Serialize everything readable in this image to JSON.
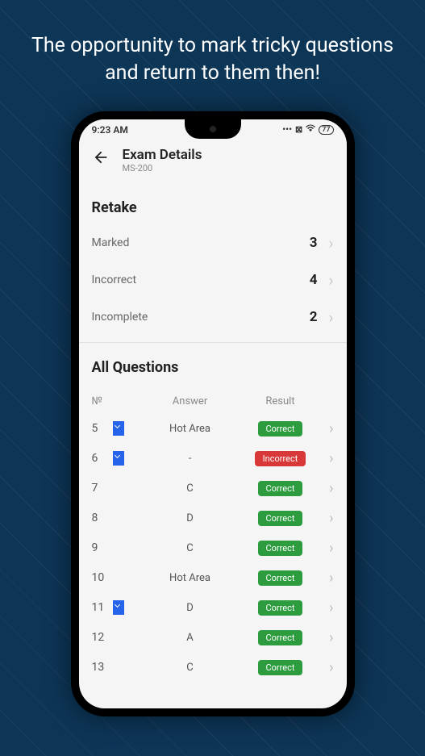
{
  "promo": "The opportunity to mark tricky questions and return to them then!",
  "statusBar": {
    "time": "9:23 AM",
    "battery": "77"
  },
  "header": {
    "title": "Exam Details",
    "subtitle": "MS-200"
  },
  "retake": {
    "title": "Retake",
    "rows": [
      {
        "label": "Marked",
        "count": "3"
      },
      {
        "label": "Incorrect",
        "count": "4"
      },
      {
        "label": "Incomplete",
        "count": "2"
      }
    ]
  },
  "questions": {
    "title": "All Questions",
    "headers": {
      "no": "№",
      "answer": "Answer",
      "result": "Result"
    },
    "rows": [
      {
        "no": "5",
        "bookmarked": true,
        "answer": "Hot Area",
        "result": "Correct",
        "resultType": "correct"
      },
      {
        "no": "6",
        "bookmarked": true,
        "answer": "-",
        "result": "Incorrect",
        "resultType": "incorrect"
      },
      {
        "no": "7",
        "bookmarked": false,
        "answer": "C",
        "result": "Correct",
        "resultType": "correct"
      },
      {
        "no": "8",
        "bookmarked": false,
        "answer": "D",
        "result": "Correct",
        "resultType": "correct"
      },
      {
        "no": "9",
        "bookmarked": false,
        "answer": "C",
        "result": "Correct",
        "resultType": "correct"
      },
      {
        "no": "10",
        "bookmarked": false,
        "answer": "Hot Area",
        "result": "Correct",
        "resultType": "correct"
      },
      {
        "no": "11",
        "bookmarked": true,
        "answer": "D",
        "result": "Correct",
        "resultType": "correct"
      },
      {
        "no": "12",
        "bookmarked": false,
        "answer": "A",
        "result": "Correct",
        "resultType": "correct"
      },
      {
        "no": "13",
        "bookmarked": false,
        "answer": "C",
        "result": "Correct",
        "resultType": "correct"
      }
    ]
  }
}
